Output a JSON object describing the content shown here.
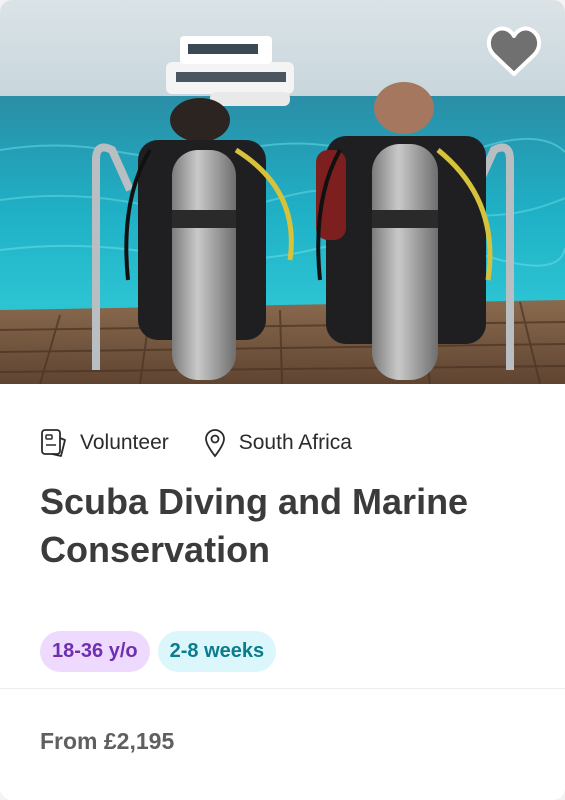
{
  "hero": {
    "image_icon": "photo-divers-on-boat-deck",
    "favorite_icon": "heart-icon"
  },
  "card": {
    "category_icon": "volunteer-id-card-icon",
    "category": "Volunteer",
    "location_icon": "map-pin-icon",
    "location": "South Africa",
    "title": "Scuba Diving and Marine Conservation",
    "tags": {
      "age": "18-36 y/o",
      "duration": "2-8 weeks"
    },
    "price": "From £2,195"
  },
  "colors": {
    "age_tag_bg": "#eedafe",
    "age_tag_text": "#6f2fb0",
    "duration_tag_bg": "#dcf7fb",
    "duration_tag_text": "#0b7c8e",
    "title_text": "#3b3b3b",
    "price_text": "#5f5f5f"
  }
}
